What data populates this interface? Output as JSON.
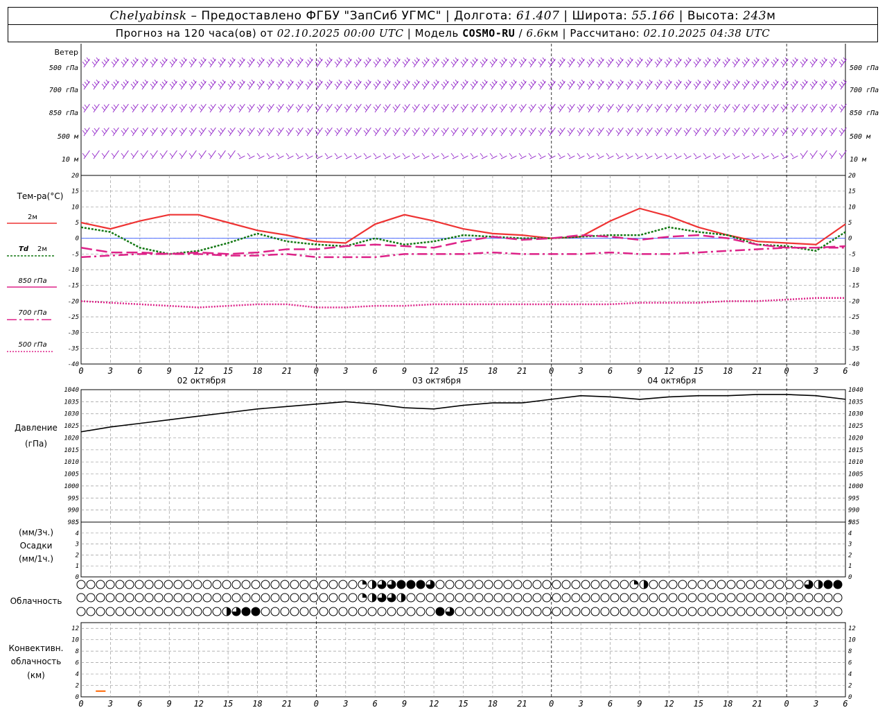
{
  "header": {
    "city": "Chelyabinsk",
    "dash": "–",
    "provider": "Предоставлено ФГБУ \"ЗапСиб УГМС\"",
    "lon_label": "Долгота:",
    "lon_value": "61.407",
    "lat_label": "Широта:",
    "lat_value": "55.166",
    "alt_label": "Высота:",
    "alt_value": "243",
    "alt_unit": "м",
    "forecast_label": "Прогноз на 120 часа(ов) от",
    "forecast_start": "02.10.2025 00:00 UTC",
    "model_label": "Модель",
    "model_name": "COSMO-RU",
    "model_res": "6.6",
    "model_res_unit": "км",
    "calc_label": "Рассчитано:",
    "calc_time": "02.10.2025 04:38 UTC",
    "sep": "|"
  },
  "chart_data": [
    {
      "type": "wind-barbs",
      "title": "Ветер",
      "levels": [
        "500 гПа",
        "700 гПа",
        "850 гПа",
        "500 м",
        "10 м"
      ],
      "level_labels_left": [
        "500 гПа",
        "700 гПа",
        "850 гПа",
        "500 м",
        "10 м"
      ],
      "color": "#9933cc"
    },
    {
      "type": "line",
      "ylabel": "Тем-ра(°C)",
      "ylim": [
        -40,
        20
      ],
      "yticks": [
        20,
        15,
        10,
        5,
        0,
        -5,
        -10,
        -15,
        -20,
        -25,
        -30,
        -35,
        -40
      ],
      "xticks": [
        "0",
        "3",
        "6",
        "9",
        "12",
        "15",
        "18",
        "21",
        "0",
        "3",
        "6",
        "9",
        "12",
        "15",
        "18",
        "21",
        "0",
        "3",
        "6",
        "9",
        "12",
        "15",
        "18",
        "21",
        "0",
        "3",
        "6"
      ],
      "day_labels": [
        "02 октября",
        "03 октября",
        "04 октября"
      ],
      "x_hours": [
        0,
        3,
        6,
        9,
        12,
        15,
        18,
        21,
        24,
        27,
        30,
        33,
        36,
        39,
        42,
        45,
        48,
        51,
        54,
        57,
        60,
        63,
        66,
        69,
        72,
        75,
        78
      ],
      "series": [
        {
          "name": "2м",
          "color": "#ee3333",
          "dash": "solid",
          "values": [
            5,
            3,
            5.5,
            7.5,
            7.5,
            5,
            2.5,
            1,
            -1,
            -1.5,
            4.5,
            7.5,
            5.5,
            3,
            1.5,
            1,
            0,
            0.5,
            5.5,
            9.5,
            7,
            3.5,
            1,
            -1,
            -1.5,
            -2,
            4.5
          ]
        },
        {
          "name": "Td 2м",
          "color": "#117711",
          "dash": "dotted",
          "values": [
            3.5,
            2,
            -3,
            -5,
            -4,
            -1.5,
            1.5,
            -1,
            -2,
            -2.5,
            0,
            -2,
            -1,
            1,
            0.5,
            0,
            0,
            0.5,
            1,
            1,
            3.5,
            2,
            1,
            -2,
            -2.5,
            -4,
            2
          ]
        },
        {
          "name": "850 гПа",
          "color": "#dd2288",
          "dash": "longdash",
          "values": [
            -3,
            -4.5,
            -4.5,
            -5,
            -4.5,
            -5,
            -4.5,
            -3.5,
            -3.5,
            -2.5,
            -2,
            -2.5,
            -3,
            -1,
            0.5,
            -0.5,
            0,
            1,
            0.5,
            -0.5,
            0.5,
            1,
            0,
            -2,
            -3,
            -3,
            -2.5
          ]
        },
        {
          "name": "700 гПа",
          "color": "#dd2288",
          "dash": "dashdot",
          "values": [
            -6,
            -5.5,
            -5,
            -5,
            -5,
            -5.5,
            -5.5,
            -5,
            -6,
            -6,
            -6,
            -5,
            -5,
            -5,
            -4.5,
            -5,
            -5,
            -5,
            -4.5,
            -5,
            -5,
            -4.5,
            -4,
            -3.5,
            -3,
            -3,
            -3
          ]
        },
        {
          "name": "500 гПа",
          "color": "#dd2288",
          "dash": "fine",
          "values": [
            -20,
            -20.5,
            -21,
            -21.5,
            -22,
            -21.5,
            -21,
            -21,
            -22,
            -22,
            -21.5,
            -21.5,
            -21,
            -21,
            -21,
            -21,
            -21,
            -21,
            -21,
            -20.5,
            -20.5,
            -20.5,
            -20,
            -20,
            -19.5,
            -19,
            -19
          ]
        }
      ]
    },
    {
      "type": "line",
      "ylabel": "Давление",
      "yunit": "(гПа)",
      "ylim": [
        985,
        1040
      ],
      "yticks": [
        1040,
        1035,
        1030,
        1025,
        1020,
        1015,
        1010,
        1005,
        1000,
        995,
        990,
        985
      ],
      "series": [
        {
          "name": "Давление",
          "color": "#000000",
          "values": [
            1022.5,
            1024.5,
            1026,
            1027.5,
            1029,
            1030.5,
            1032,
            1033,
            1034,
            1035,
            1034,
            1032.5,
            1032,
            1033.5,
            1034.5,
            1034.5,
            1036,
            1037.5,
            1037,
            1036,
            1037,
            1037.5,
            1037.5,
            1038,
            1038,
            1037.5,
            1036
          ]
        }
      ]
    },
    {
      "type": "bar",
      "ylabel": "Осадки",
      "ylabel_top": "(мм/3ч.)",
      "ylabel_bottom": "(мм/1ч.)",
      "ylim": [
        0,
        5
      ],
      "yticks": [
        5,
        4,
        3,
        2,
        1,
        0
      ],
      "values": []
    },
    {
      "type": "table",
      "ylabel": "Облачность",
      "rows": 3,
      "columns": 79
    },
    {
      "type": "bar",
      "ylabel": "Конвективн.",
      "ylabel2": "облачность",
      "yunit": "(км)",
      "ylim": [
        0,
        13
      ],
      "yticks": [
        12,
        10,
        8,
        6,
        4,
        2,
        0
      ],
      "x_range_hours": [
        1.5,
        2.5
      ],
      "values": [
        1
      ],
      "color": "#ff6600"
    }
  ],
  "legend": {
    "t2m": "2м",
    "td": "Td",
    "td2": "2м",
    "p850": "850 гПа",
    "p700": "700 гПа",
    "p500": "500 гПа"
  }
}
